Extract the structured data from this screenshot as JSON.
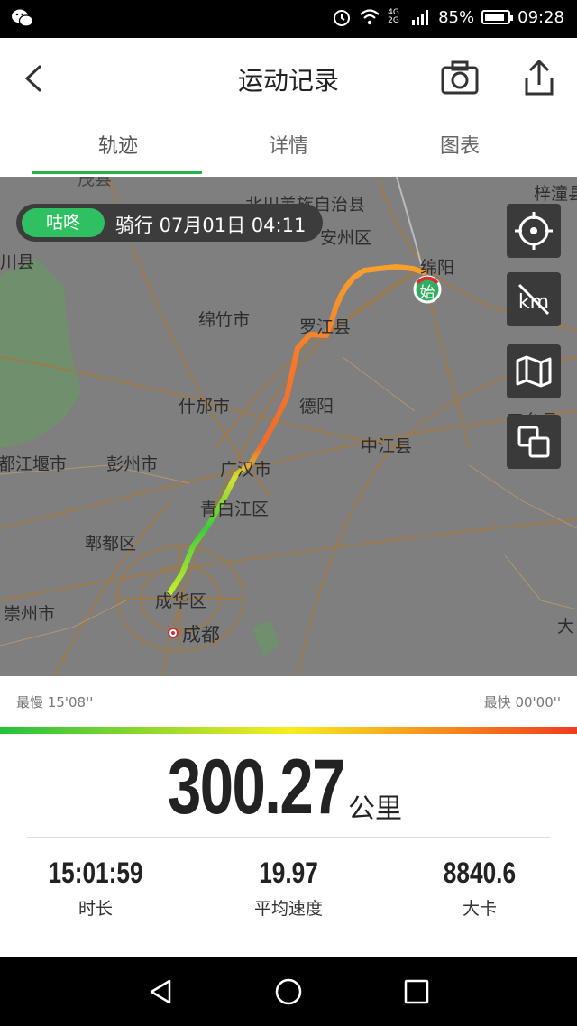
{
  "status_bar": {
    "app_icon": "wechat-icon",
    "signal_text": "4G 2G",
    "battery_percent": "85%",
    "battery_level": 0.85,
    "time": "09:28"
  },
  "header": {
    "title": "运动记录",
    "back_icon": "back-arrow-icon",
    "camera_icon": "camera-icon",
    "share_icon": "share-icon"
  },
  "tabs": [
    {
      "label": "轨迹",
      "active": true
    },
    {
      "label": "详情",
      "active": false
    },
    {
      "label": "图表",
      "active": false
    }
  ],
  "map": {
    "ride_badge": "咕咚",
    "ride_info": "骑行  07月01日 04:11",
    "start_marker": "始",
    "labels": [
      "北川羌族自治县",
      "安州区",
      "绵阳",
      "梓潼县",
      "绵竹市",
      "罗江县",
      "什邡市",
      "德阳",
      "中江县",
      "三台县",
      "都江堰市",
      "彭州市",
      "广汉市",
      "青白江区",
      "郫都区",
      "崇州市",
      "成华区",
      "成都",
      "川县",
      "茂县",
      "大"
    ],
    "buttons": [
      "locate-icon",
      "km-toggle-icon",
      "map-layer-icon",
      "overlay-toggle-icon"
    ]
  },
  "speed_scale": {
    "slowest": "最慢 15'08''",
    "fastest": "最快 00'00''"
  },
  "summary": {
    "distance": "300.27",
    "distance_unit": "公里",
    "stats": [
      {
        "value": "15:01:59",
        "label": "时长"
      },
      {
        "value": "19.97",
        "label": "平均速度"
      },
      {
        "value": "8840.6",
        "label": "大卡"
      }
    ]
  },
  "nav_bar": [
    "back-triangle-icon",
    "home-circle-icon",
    "recents-square-icon"
  ]
}
